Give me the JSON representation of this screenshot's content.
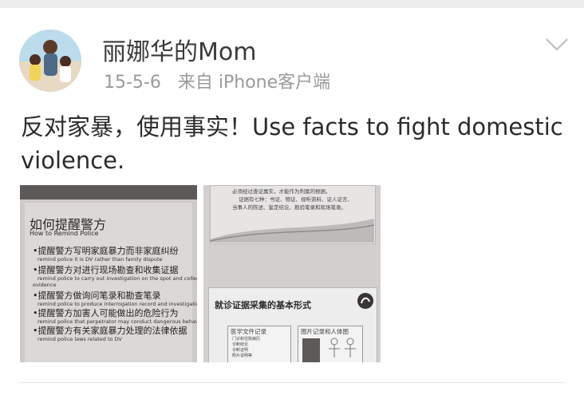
{
  "post": {
    "author": "丽娜华的Mom",
    "date": "15-5-6",
    "source": "来自 iPhone客户端",
    "text": "反对家暴，使用事实！Use facts to fight domestic violence."
  },
  "photo1": {
    "title_zh": "如何提醒警方",
    "title_en": "How to Remind Police",
    "bullets": [
      {
        "zh": "•提醒警方写明家庭暴力而非家庭纠纷",
        "en": "remind police it is DV rather than family dispute"
      },
      {
        "zh": "•提醒警方对进行现场勘查和收集证据",
        "en": "remind police to carry out investigation on the spot and collect"
      },
      {
        "zh": "",
        "en": "evidence"
      },
      {
        "zh": "•提醒警方做询问笔录和勘查笔录",
        "en": "remind police to produce interrogation record and investigation recor"
      },
      {
        "zh": "•提醒警方加害人可能做出的危险行为",
        "en": "remind police that perpetrator may conduct dangerous behavior"
      },
      {
        "zh": "•提醒警方有关家庭暴力处理的法律依据",
        "en": "remind police laws related to DV"
      }
    ]
  },
  "photo2": {
    "top_line1": "必须经过查证属实，才能作为判案的根据。",
    "top_line2": "证据有七种：书证、物证、视听资料、证人证言、",
    "top_line3": "当事人的陈述、鉴定结论、勘验笔录和现场笔录。",
    "section_title": "就诊证据采集的基本形式",
    "box1_title": "医学文件记录",
    "box1_items": [
      "门诊和住院病历",
      "诊断结论",
      "诊断证明",
      "照片说明等"
    ],
    "box2_title": "图片记录和人体图"
  },
  "colors": {
    "username": "#3a3a3a",
    "meta": "#9a9a9a",
    "text": "#2b2b2b"
  }
}
